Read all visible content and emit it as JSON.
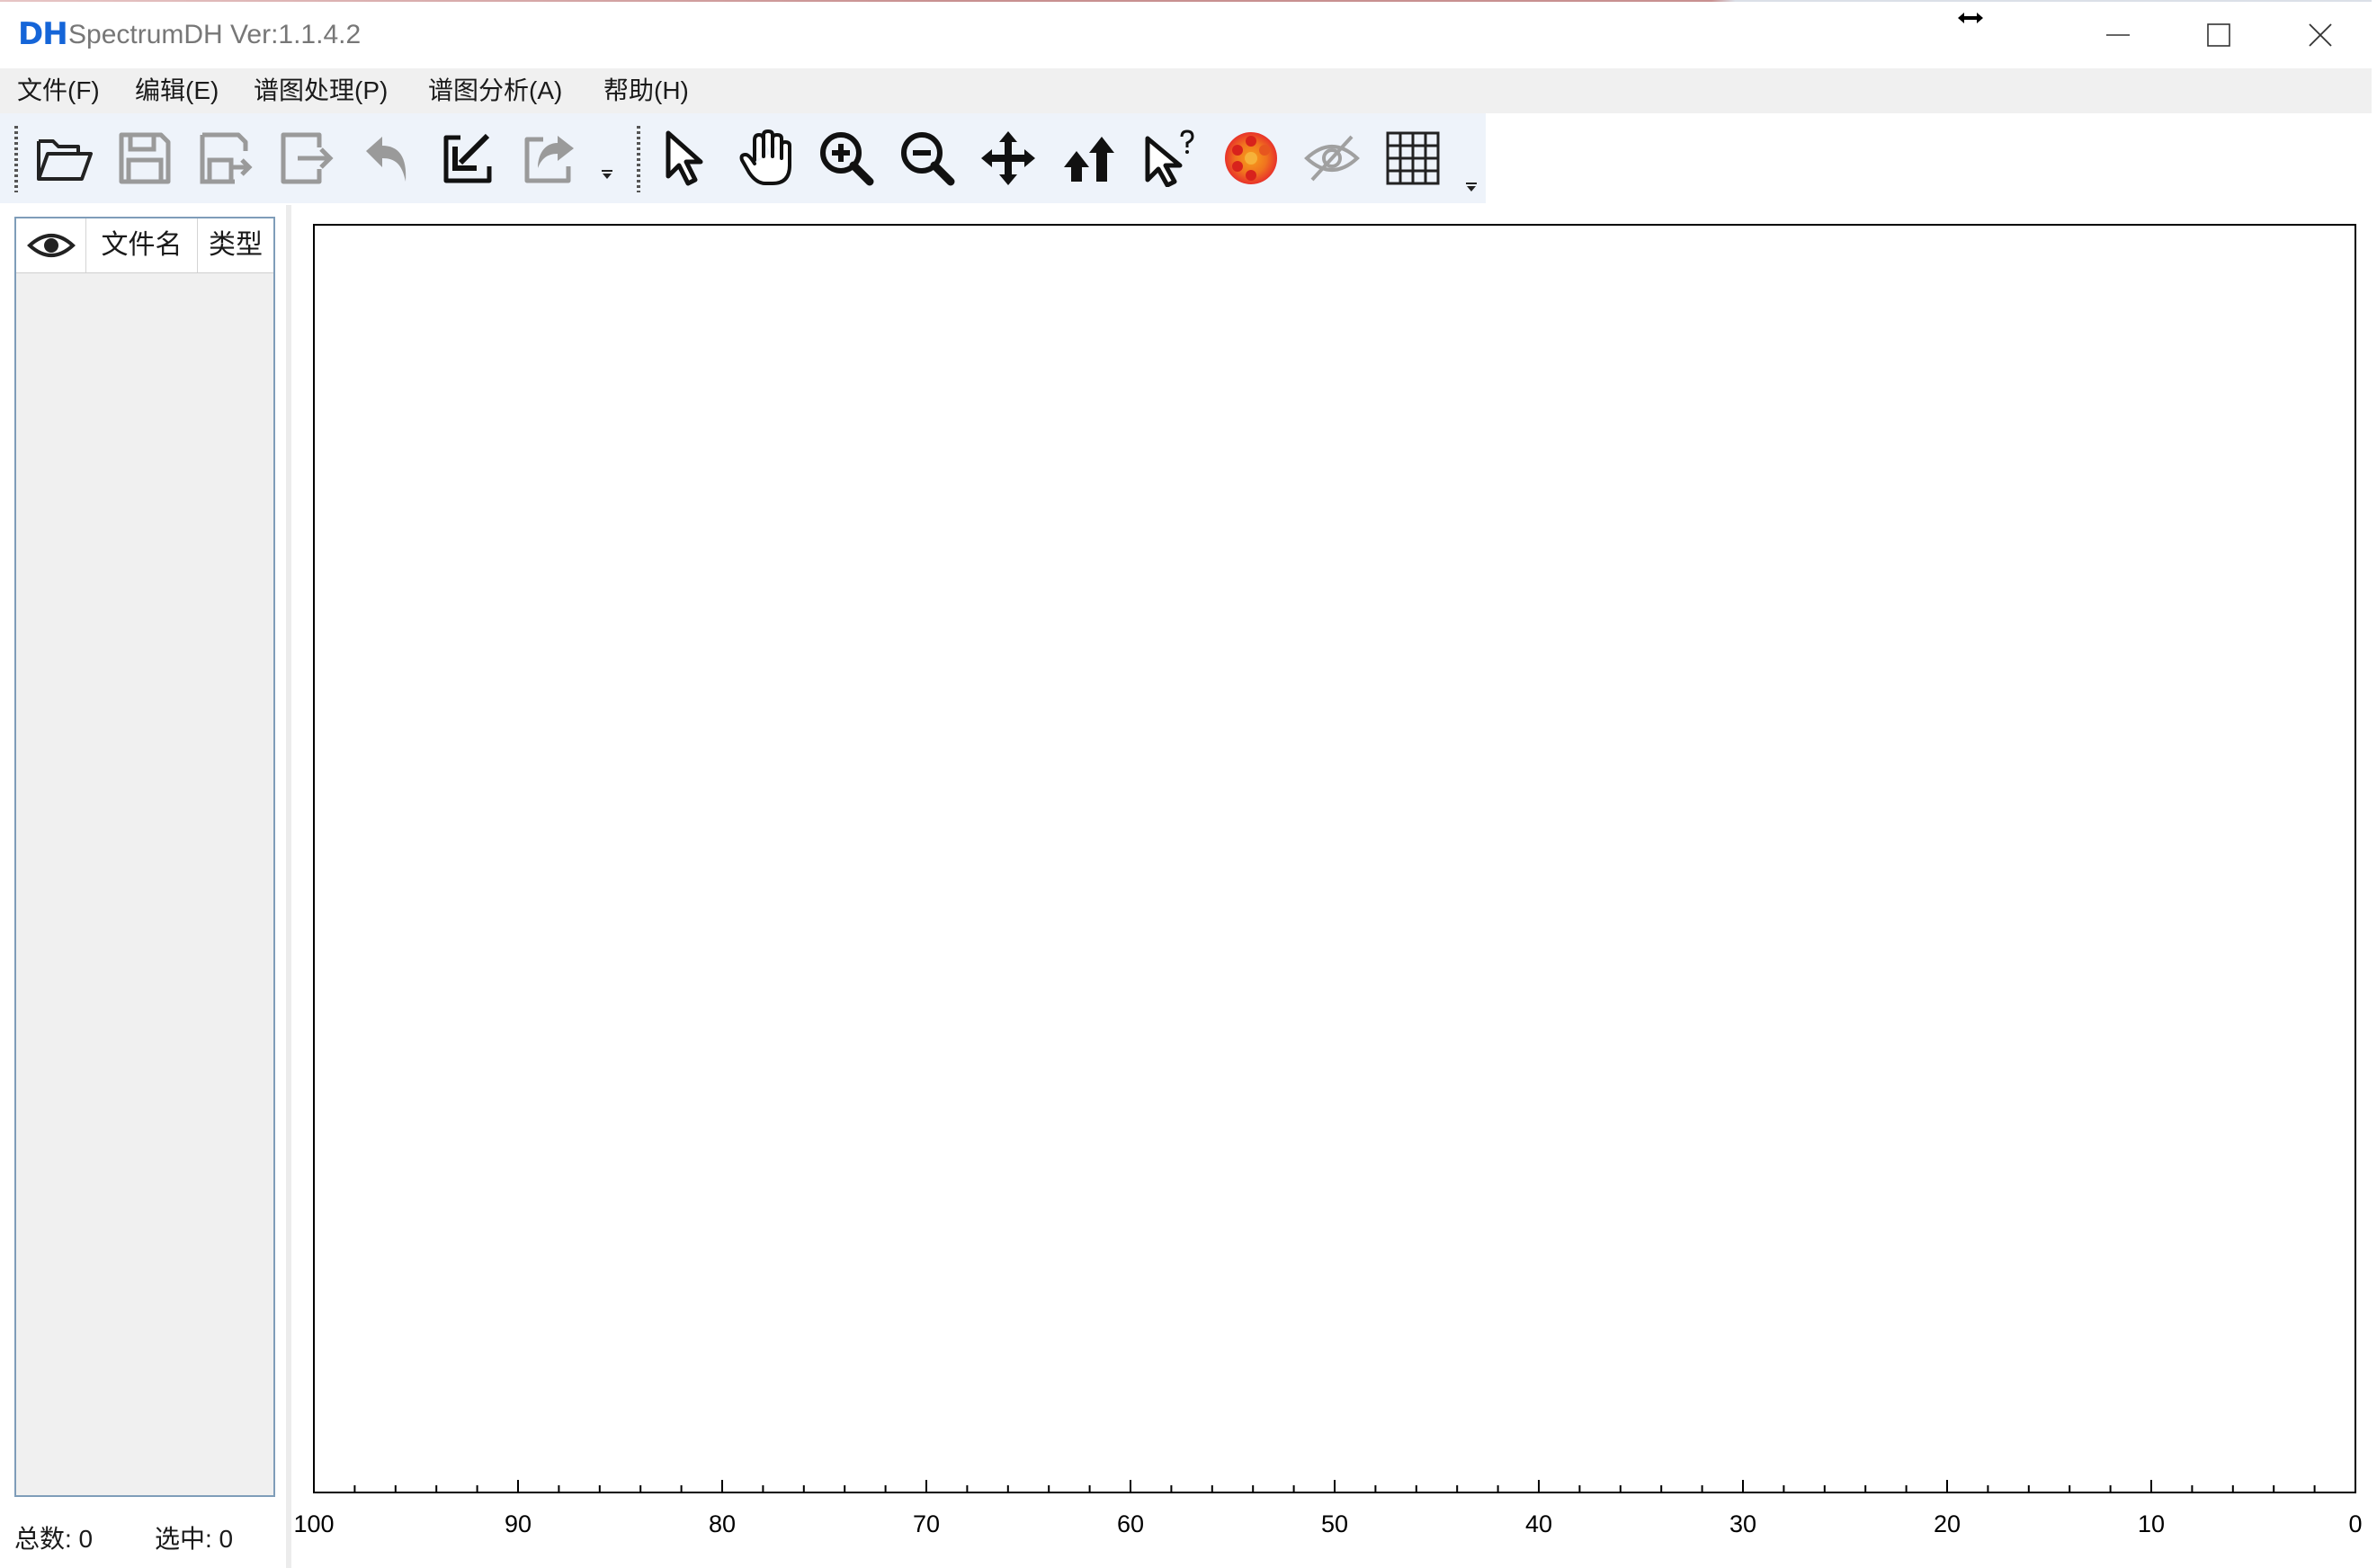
{
  "window": {
    "logo": "DH",
    "title": "SpectrumDH Ver:1.1.4.2",
    "controls": [
      "minimize-icon",
      "maximize-icon",
      "close-icon"
    ]
  },
  "menu": [
    {
      "label": "文件(F)"
    },
    {
      "label": "编辑(E)"
    },
    {
      "label": "谱图处理(P)"
    },
    {
      "label": "谱图分析(A)"
    },
    {
      "label": "帮助(H)"
    }
  ],
  "toolbar": {
    "groups": [
      [
        "open-folder-icon",
        "save-icon",
        "save-as-icon",
        "export-icon",
        "undo-icon",
        "import-icon",
        "share-icon"
      ],
      [
        "select-pointer-icon",
        "pan-hand-icon",
        "zoom-in-icon",
        "zoom-out-icon",
        "move-icon",
        "stack-up-icon",
        "help-pointer-icon",
        "color-palette-icon",
        "hide-icon",
        "grid-icon"
      ]
    ],
    "colors": {
      "palette_outer": "#e8322a",
      "palette_inner": "#f7a21b",
      "disabled": "#a0a0a0"
    }
  },
  "file_list": {
    "columns": [
      "visibility-eye-icon",
      "文件名",
      "类型"
    ],
    "rows": []
  },
  "status": {
    "total": "总数: 0",
    "selected": "选中: 0"
  },
  "chart_data": {
    "type": "line",
    "title": "",
    "xlabel": "",
    "ylabel": "",
    "xlim": [
      100,
      0
    ],
    "x_reversed": true,
    "x_ticks": [
      100,
      90,
      80,
      70,
      60,
      50,
      40,
      30,
      20,
      10,
      0
    ],
    "minor_tick_step": 2,
    "series": [],
    "grid": false
  }
}
